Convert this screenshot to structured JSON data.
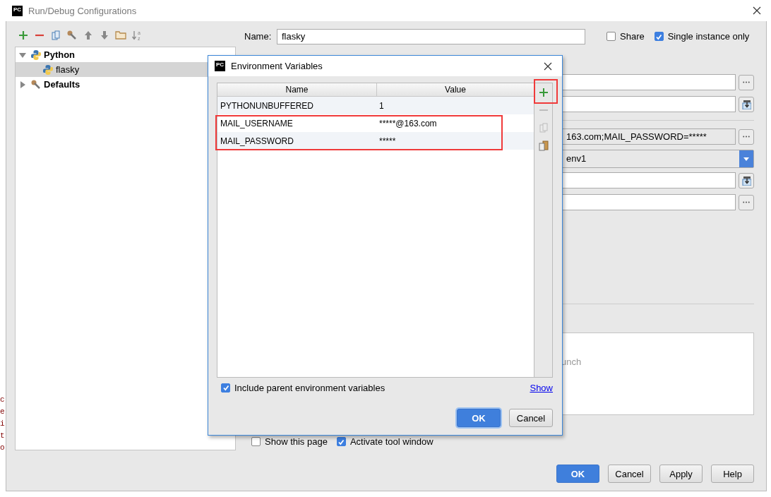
{
  "window": {
    "logo": "PC",
    "title": "Run/Debug Configurations"
  },
  "background_fragments": [
    "c",
    "e",
    "i",
    "t",
    "o"
  ],
  "toolbar": [
    {
      "kind": "add"
    },
    {
      "kind": "remove"
    },
    {
      "kind": "copy"
    },
    {
      "kind": "edit-defaults"
    },
    {
      "kind": "up"
    },
    {
      "kind": "down"
    },
    {
      "kind": "folder"
    },
    {
      "kind": "sort",
      "letters": [
        "a",
        "z"
      ]
    }
  ],
  "tree": [
    {
      "label": "Python",
      "kind": "group",
      "expanded": true,
      "selected": false,
      "children": [
        {
          "label": "flasky",
          "kind": "config",
          "selected": true
        }
      ]
    },
    {
      "label": "Defaults",
      "kind": "defaults",
      "expanded": false,
      "selected": false
    }
  ],
  "name_field": {
    "label": "Name:",
    "value": "flasky"
  },
  "header_checks": [
    {
      "label": "Share",
      "checked": false
    },
    {
      "label": "Single instance only",
      "checked": true
    }
  ],
  "form_rows": [
    {
      "kind": "browse"
    },
    {
      "kind": "macro"
    },
    {
      "kind": "separator"
    },
    {
      "kind": "browse",
      "value": "163.com;MAIL_PASSWORD=*****"
    },
    {
      "kind": "combo",
      "value": "env1"
    },
    {
      "kind": "macro"
    },
    {
      "kind": "browse"
    }
  ],
  "log_box": {
    "text": "unch"
  },
  "options": [
    {
      "label": "Show this page",
      "checked": false
    },
    {
      "label": "Activate tool window",
      "checked": true
    }
  ],
  "buttons": [
    {
      "label": "OK",
      "default": true
    },
    {
      "label": "Cancel",
      "default": false
    },
    {
      "label": "Apply",
      "default": false
    },
    {
      "label": "Help",
      "default": false
    }
  ],
  "dialog": {
    "logo": "PC",
    "title": "Environment Variables",
    "columns": [
      "Name",
      "Value"
    ],
    "rows": [
      {
        "name": "PYTHONUNBUFFERED",
        "value": "1",
        "highlighted": false
      },
      {
        "name": "MAIL_USERNAME",
        "value": "*****@163.com",
        "highlighted": true
      },
      {
        "name": "MAIL_PASSWORD",
        "value": "*****",
        "highlighted": true
      }
    ],
    "side_tools": [
      {
        "kind": "add",
        "disabled": false,
        "highlighted": true
      },
      {
        "kind": "remove",
        "disabled": true
      },
      {
        "kind": "copy",
        "disabled": true
      },
      {
        "kind": "paste",
        "disabled": false
      }
    ],
    "include_parent": {
      "label": "Include parent environment variables",
      "checked": true
    },
    "show_link": "Show",
    "buttons": [
      {
        "label": "OK",
        "default": true
      },
      {
        "label": "Cancel",
        "default": false
      }
    ]
  }
}
